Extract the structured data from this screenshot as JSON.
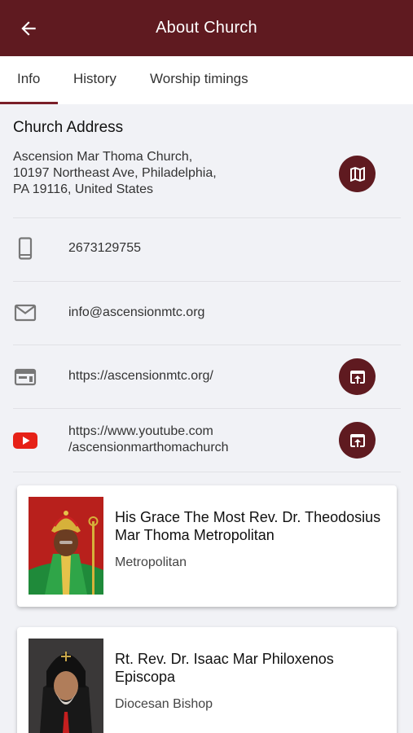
{
  "header": {
    "title": "About Church"
  },
  "tabs": [
    {
      "label": "Info"
    },
    {
      "label": "History"
    },
    {
      "label": "Worship timings"
    }
  ],
  "address_section": {
    "title": "Church Address",
    "address": "Ascension Mar Thoma Church,\n10197 Northeast Ave, Philadelphia,\nPA 19116, United States"
  },
  "contacts": {
    "phone": "2673129755",
    "email": "info@ascensionmtc.org",
    "website": "https://ascensionmtc.org/",
    "youtube": "https://www.youtube.com\n/ascensionmarthomachurch"
  },
  "clergy": [
    {
      "name": "His Grace The Most Rev. Dr. Theodosius Mar Thoma Metropolitan",
      "role": "Metropolitan"
    },
    {
      "name": "Rt. Rev. Dr. Isaac Mar Philoxenos Episcopa",
      "role": "Diocesan Bishop"
    }
  ],
  "icons": {
    "back": "arrow-left-icon",
    "map": "map-icon",
    "phone": "phone-icon",
    "email": "mail-icon",
    "website": "web-icon",
    "youtube": "youtube-icon",
    "open": "open-in-browser-icon"
  },
  "colors": {
    "primary": "#5f1a20",
    "background": "#f1f2f6",
    "youtube": "#e62117"
  }
}
